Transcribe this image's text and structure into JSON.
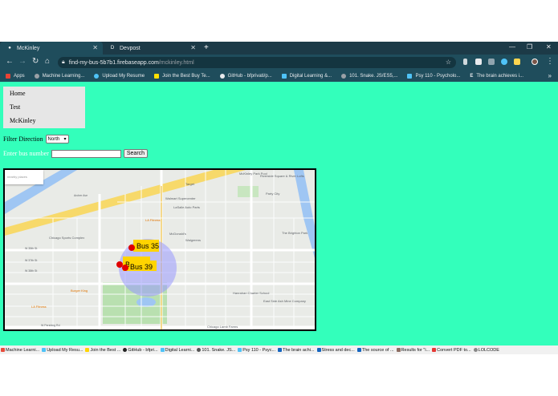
{
  "browser": {
    "tabs": [
      {
        "title": "McKinley",
        "active": true
      },
      {
        "title": "Devpost",
        "active": false,
        "favicon_letter": "D"
      }
    ],
    "url_host": "find-my-bus-5b7b1.firebaseapp.com",
    "url_path": "/mckinley.html",
    "bookmarks": [
      {
        "label": "Apps",
        "icon": "apps-grid-icon",
        "color": "#ea4335"
      },
      {
        "label": "Machine Learning...",
        "icon": "globe-icon",
        "color": "#9aa0a6"
      },
      {
        "label": "Upload My Resume",
        "icon": "blue-circle-icon",
        "color": "#4fc3f7"
      },
      {
        "label": "Join the Best Buy Te...",
        "icon": "bestbuy-icon",
        "color": "#ffe000"
      },
      {
        "label": "GitHub - bfprivati/p...",
        "icon": "github-icon",
        "color": "#e8eaed"
      },
      {
        "label": "Digital Learning &...",
        "icon": "sparkle-icon",
        "color": "#4fc3f7"
      },
      {
        "label": "101. Snake. JS/ES5,...",
        "icon": "globe-icon",
        "color": "#9aa0a6"
      },
      {
        "label": "Psy 110 - Psycholo...",
        "icon": "cloud-icon",
        "color": "#4fc3f7"
      },
      {
        "label": "The brain achieves i...",
        "icon": "e-icon",
        "color": "#e8eaed",
        "letter": "E"
      }
    ],
    "bookmarks_more": "»"
  },
  "page": {
    "nav": [
      "Home",
      "Test",
      "McKinley"
    ],
    "filter_label": "Filter Direction",
    "direction_value": "North",
    "bus_label": "Enter bus number",
    "search_button": "Search",
    "map_search_placeholder": "nearby places",
    "map": {
      "labels": {
        "mckinley_park_pool": "McKinley Park Pool",
        "riverside": "Riverside Square & River Lofts",
        "target": "Target",
        "party_city": "Party City",
        "walmart": "Walmart Supercenter",
        "la_fitness_top": "LA Fitness",
        "lasalle": "LaSalle Auto Parts",
        "brighton": "The Brighton Park",
        "chicago_sports": "Chicago Sports Complex",
        "walgreens": "Walgreens",
        "mcdonalds": "McDonald's",
        "burger_king": "Burger King",
        "la_fitness_bottom": "LA Fitness",
        "hanrahan": "Hanrahan Charter School",
        "east_side": "East Side Ash Mine Company",
        "chicago_lamb": "Chicago Lamb Farms",
        "street_35th": "W 35th St",
        "street_37th": "W 37th St",
        "street_38th": "W 38th St",
        "archer": "Archer Ave",
        "pershing": "W Pershing Rd"
      },
      "buses": [
        {
          "label": "Bus 35"
        },
        {
          "label": "Bus 62"
        },
        {
          "label": "Bus 39"
        }
      ],
      "colors": {
        "bus_label_bg": "#ffd400",
        "marker": "#e00000",
        "radius_circle": "#9999ff"
      }
    }
  },
  "bottom_bookmarks": [
    {
      "label": "Machine Learni...",
      "color": "#e74c3c"
    },
    {
      "label": "Upload My Resu...",
      "color": "#4fc3f7"
    },
    {
      "label": "Join the Best ...",
      "color": "#ffd400"
    },
    {
      "label": "GitHub - bfpri...",
      "color": "#222222"
    },
    {
      "label": "Digital Learni...",
      "color": "#4fc3f7"
    },
    {
      "label": "101. Snake. JS...",
      "color": "#555555"
    },
    {
      "label": "Psy 110 - Psyc...",
      "color": "#4fc3f7"
    },
    {
      "label": "The brain achi...",
      "color": "#1565c0"
    },
    {
      "label": "Stress and dec...",
      "color": "#1565c0"
    },
    {
      "label": "The source of ...",
      "color": "#1565c0"
    },
    {
      "label": "Results for \"i...",
      "color": "#8d6e63"
    },
    {
      "label": "Convert PDF to...",
      "color": "#e53935"
    },
    {
      "label": "LOLCODE",
      "color": "#888888"
    }
  ],
  "colors": {
    "page_bg": "#33ffbb",
    "chrome_dark": "#1f4d5c"
  }
}
